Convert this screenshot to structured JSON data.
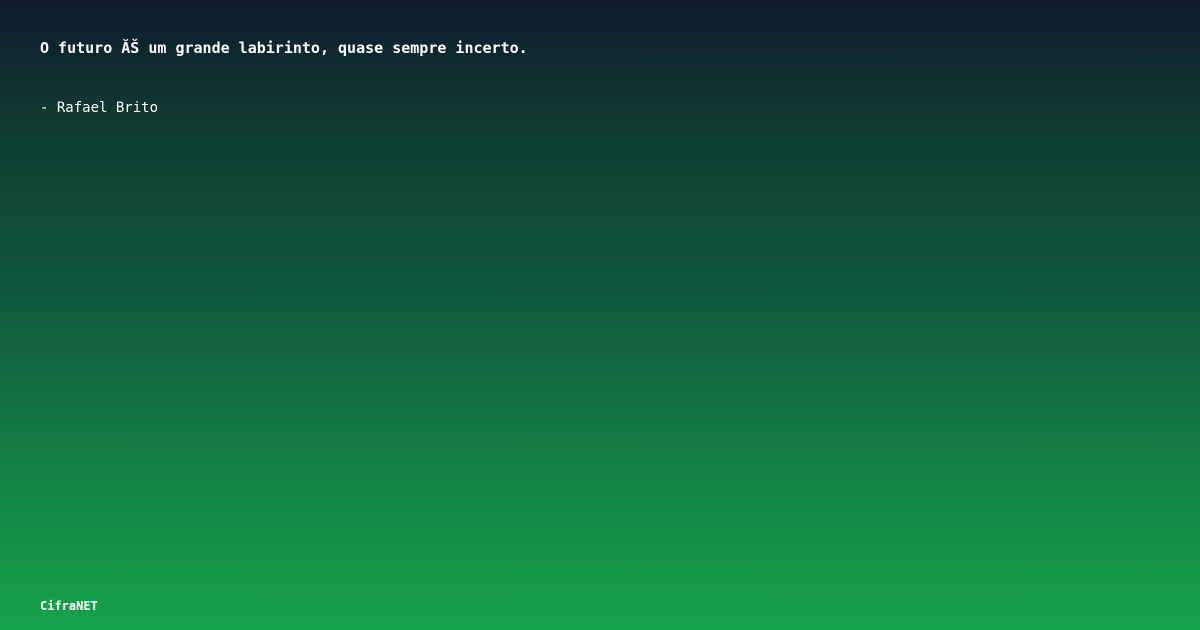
{
  "quote": {
    "text": "O futuro ĂŠ um grande labirinto, quase sempre incerto.",
    "author": "- Rafael Brito"
  },
  "brand": {
    "name": "CifraNET"
  },
  "theme": {
    "gradient_top": "#0e1a2c",
    "gradient_bottom": "#16a34a",
    "text_color": "#ffffff"
  }
}
